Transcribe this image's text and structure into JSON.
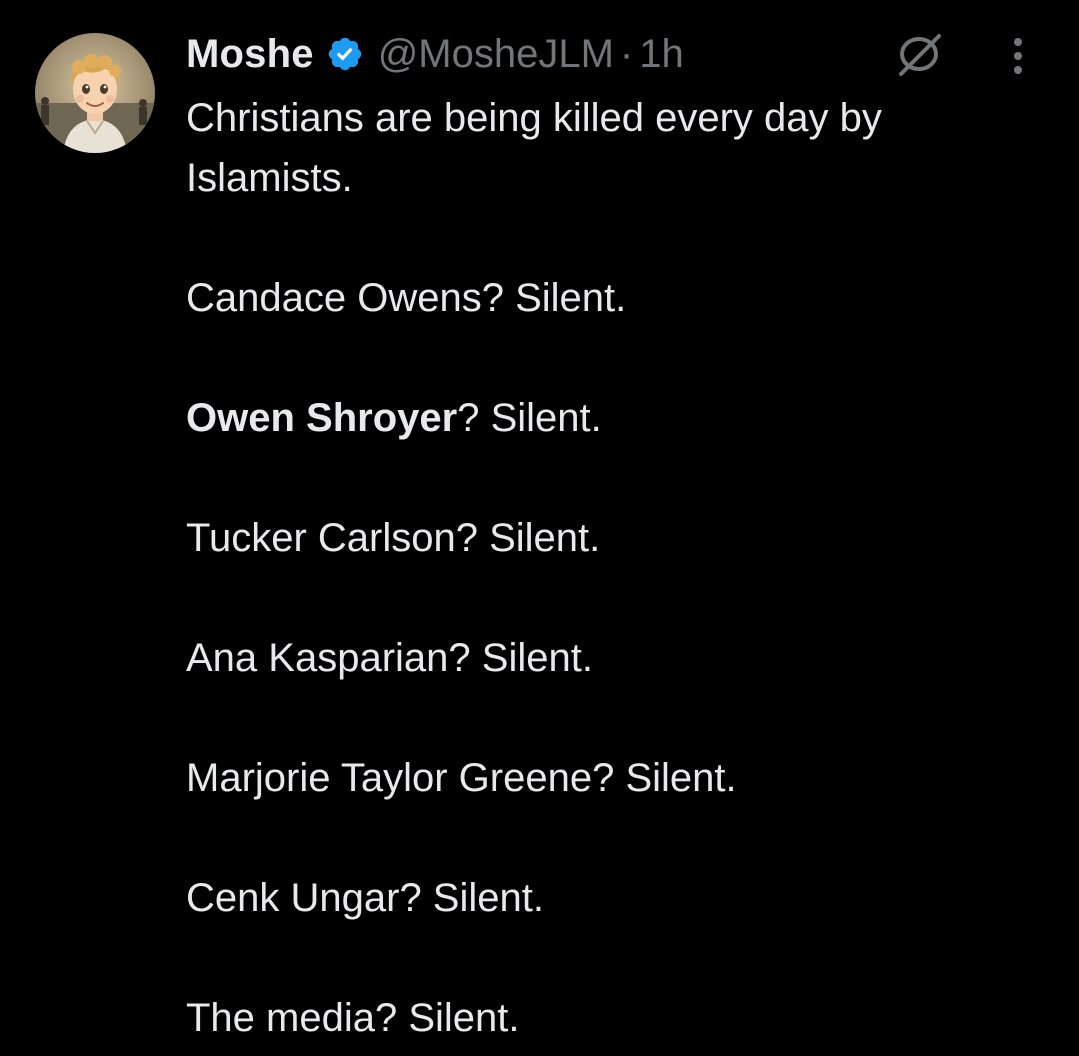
{
  "tweet": {
    "display_name": "Moshe",
    "handle": "@MosheJLM",
    "separator": "·",
    "time": "1h",
    "verified": true,
    "lines": [
      "Christians are being killed every day by",
      "Islamists."
    ],
    "entries": [
      {
        "name": "Candace Owens",
        "suffix": "? Silent."
      },
      {
        "name": "Owen Shroyer",
        "suffix": "? Silent.",
        "bold_name": true
      },
      {
        "name": "Tucker Carlson",
        "suffix": "? Silent."
      },
      {
        "name": "Ana Kasparian",
        "suffix": "? Silent."
      },
      {
        "name": "Marjorie Taylor Greene",
        "suffix": "? Silent."
      },
      {
        "name": "Cenk Ungar",
        "suffix": "? Silent."
      },
      {
        "name": "The media",
        "suffix": "? Silent."
      }
    ]
  },
  "icons": {
    "avatar": "avatar-image",
    "verified": "verified-badge-icon",
    "grok": "grok-icon",
    "more": "more-options-icon"
  },
  "colors": {
    "background": "#000000",
    "text": "#e7e9ea",
    "secondary": "#71767b",
    "verified": "#1d9bf0"
  }
}
